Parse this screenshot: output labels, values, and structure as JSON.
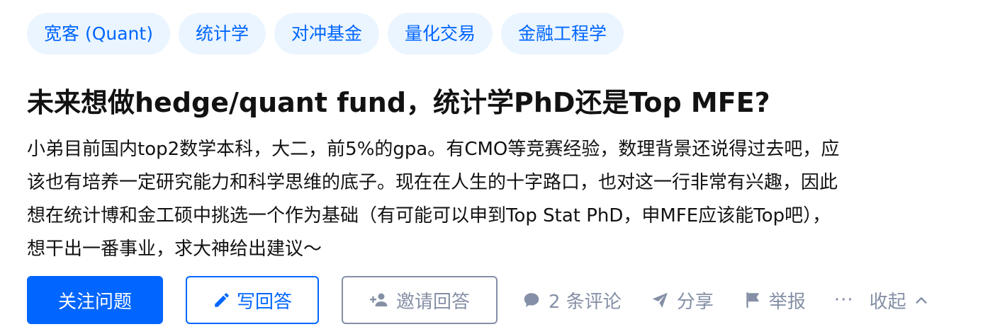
{
  "topics": [
    "宽客 (Quant)",
    "统计学",
    "对冲基金",
    "量化交易",
    "金融工程学"
  ],
  "question": {
    "title": "未来想做hedge/quant fund，统计学PhD还是Top MFE?",
    "detail_lines": [
      "小弟目前国内top2数学本科，大二，前5%的gpa。有CMO等竞赛经验，数理背景还说得过去吧，应",
      "该也有培养一定研究能力和科学思维的底子。现在在人生的十字路口，也对这一行非常有兴趣，因此",
      "想在统计博和金工硕中挑选一个作为基础（有可能可以申到Top Stat PhD，申MFE应该能Top吧），",
      "想干出一番事业，求大神给出建议～"
    ]
  },
  "actions": {
    "follow_label": "关注问题",
    "write_label": "写回答",
    "invite_label": "邀请回答",
    "comment_label": "2 条评论",
    "share_label": "分享",
    "report_label": "举报",
    "more_label": "···",
    "collapse_label": "收起"
  },
  "colors": {
    "brand": "#0066ff",
    "tag_bg": "#ebf5ff",
    "muted": "#8590a6",
    "text": "#121212"
  }
}
